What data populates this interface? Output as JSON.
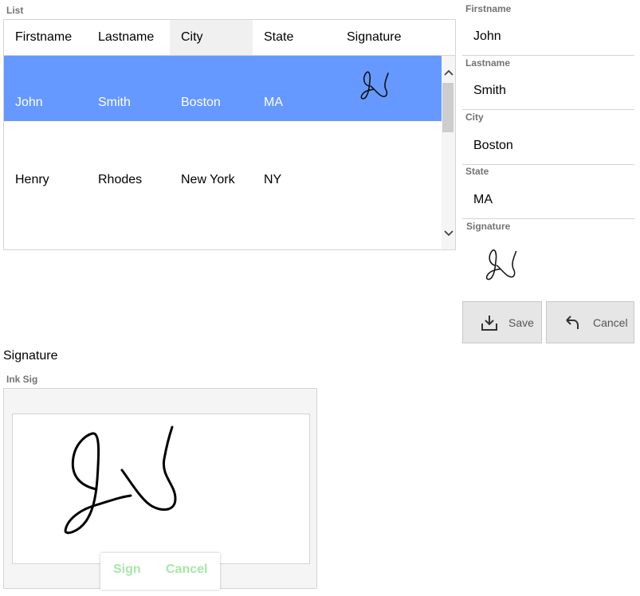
{
  "list": {
    "label": "List",
    "columns": [
      "Firstname",
      "Lastname",
      "City",
      "State",
      "Signature"
    ],
    "rows": [
      {
        "firstname": "John",
        "lastname": "Smith",
        "city": "Boston",
        "state": "MA",
        "has_signature": true,
        "selected": true
      },
      {
        "firstname": "Henry",
        "lastname": "Rhodes",
        "city": "New York",
        "state": "NY",
        "has_signature": false,
        "selected": false
      }
    ],
    "scroll_up_icon": "chevron-up-icon",
    "scroll_down_icon": "chevron-down-icon"
  },
  "form": {
    "fields": [
      {
        "label": "Firstname",
        "value": "John"
      },
      {
        "label": "Lastname",
        "value": "Smith"
      },
      {
        "label": "City",
        "value": "Boston"
      },
      {
        "label": "State",
        "value": "MA"
      }
    ],
    "signature_label": "Signature",
    "save_label": "Save",
    "save_icon": "download-icon",
    "cancel_label": "Cancel",
    "cancel_icon": "undo-arrow-icon"
  },
  "signature_section": {
    "title": "Signature",
    "ink_label": "Ink Sig",
    "sign_label": "Sign",
    "cancel_label": "Cancel"
  },
  "colors": {
    "selected_row": "#6699ff",
    "ink_button_text": "#a8e6a8",
    "button_bg": "#e6e6e6"
  }
}
